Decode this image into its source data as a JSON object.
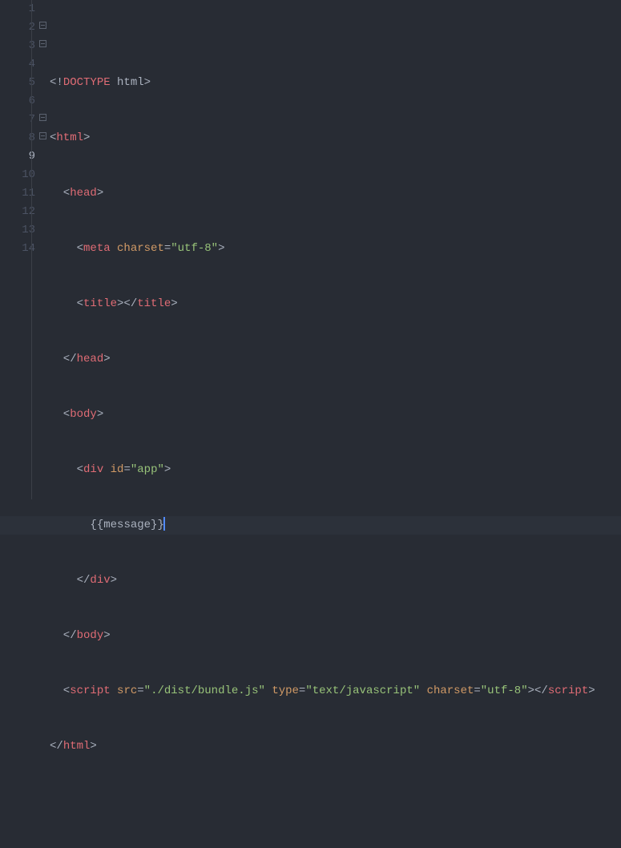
{
  "lineNumbers": [
    "1",
    "2",
    "3",
    "4",
    "5",
    "6",
    "7",
    "8",
    "9",
    "10",
    "11",
    "12",
    "13",
    "14"
  ],
  "foldLines": [
    2,
    3,
    7,
    8
  ],
  "selectedLine": 9,
  "cursorAfter": "l9_d",
  "code": {
    "l1": [
      {
        "cls": "doctype",
        "t": "<!"
      },
      {
        "cls": "tag",
        "t": "DOCTYPE"
      },
      {
        "cls": "doctype",
        "t": " html>"
      }
    ],
    "l2": [
      {
        "cls": "tag-b",
        "t": "<"
      },
      {
        "cls": "tag",
        "t": "html"
      },
      {
        "cls": "tag-b",
        "t": ">"
      }
    ],
    "l3": [
      {
        "cls": "tag-b",
        "t": "  <"
      },
      {
        "cls": "tag",
        "t": "head"
      },
      {
        "cls": "tag-b",
        "t": ">"
      }
    ],
    "l4": [
      {
        "cls": "tag-b",
        "t": "    <"
      },
      {
        "cls": "tag",
        "t": "meta"
      },
      {
        "cls": "txt",
        "t": " "
      },
      {
        "cls": "attr",
        "t": "charset"
      },
      {
        "cls": "eq",
        "t": "="
      },
      {
        "cls": "str",
        "t": "\"utf-8\""
      },
      {
        "cls": "tag-b",
        "t": ">"
      }
    ],
    "l5": [
      {
        "cls": "tag-b",
        "t": "    <"
      },
      {
        "cls": "tag",
        "t": "title"
      },
      {
        "cls": "tag-b",
        "t": "></"
      },
      {
        "cls": "tag",
        "t": "title"
      },
      {
        "cls": "tag-b",
        "t": ">"
      }
    ],
    "l6": [
      {
        "cls": "tag-b",
        "t": "  </"
      },
      {
        "cls": "tag",
        "t": "head"
      },
      {
        "cls": "tag-b",
        "t": ">"
      }
    ],
    "l7": [
      {
        "cls": "tag-b",
        "t": "  <"
      },
      {
        "cls": "tag",
        "t": "body"
      },
      {
        "cls": "tag-b",
        "t": ">"
      }
    ],
    "l8": [
      {
        "cls": "tag-b",
        "t": "    <"
      },
      {
        "cls": "tag",
        "t": "div"
      },
      {
        "cls": "txt",
        "t": " "
      },
      {
        "cls": "attr",
        "t": "id"
      },
      {
        "cls": "eq",
        "t": "="
      },
      {
        "cls": "str",
        "t": "\"app\""
      },
      {
        "cls": "tag-b",
        "t": ">"
      }
    ],
    "l9_a": {
      "cls": "txt",
      "t": "      "
    },
    "l9_b": {
      "cls": "txt",
      "t": "{{"
    },
    "l9_c": {
      "cls": "txt",
      "t": "message"
    },
    "l9_d": {
      "cls": "txt",
      "t": "}}"
    },
    "l10": [
      {
        "cls": "tag-b",
        "t": "    </"
      },
      {
        "cls": "tag",
        "t": "div"
      },
      {
        "cls": "tag-b",
        "t": ">"
      }
    ],
    "l11": [
      {
        "cls": "tag-b",
        "t": "  </"
      },
      {
        "cls": "tag",
        "t": "body"
      },
      {
        "cls": "tag-b",
        "t": ">"
      }
    ],
    "l12": [
      {
        "cls": "tag-b",
        "t": "  <"
      },
      {
        "cls": "tag",
        "t": "script"
      },
      {
        "cls": "txt",
        "t": " "
      },
      {
        "cls": "attr",
        "t": "src"
      },
      {
        "cls": "eq",
        "t": "="
      },
      {
        "cls": "str",
        "t": "\"./dist/bundle.js\""
      },
      {
        "cls": "txt",
        "t": " "
      },
      {
        "cls": "attr",
        "t": "type"
      },
      {
        "cls": "eq",
        "t": "="
      },
      {
        "cls": "str",
        "t": "\"text/javascript\""
      },
      {
        "cls": "txt",
        "t": " "
      },
      {
        "cls": "attr",
        "t": "charset"
      },
      {
        "cls": "eq",
        "t": "="
      },
      {
        "cls": "str",
        "t": "\"utf-8\""
      },
      {
        "cls": "tag-b",
        "t": "></"
      },
      {
        "cls": "tag",
        "t": "script"
      },
      {
        "cls": "tag-b",
        "t": ">"
      }
    ],
    "l13": [
      {
        "cls": "tag-b",
        "t": "</"
      },
      {
        "cls": "tag",
        "t": "html"
      },
      {
        "cls": "tag-b",
        "t": ">"
      }
    ],
    "l14": [
      {
        "cls": "txt",
        "t": ""
      }
    ]
  }
}
